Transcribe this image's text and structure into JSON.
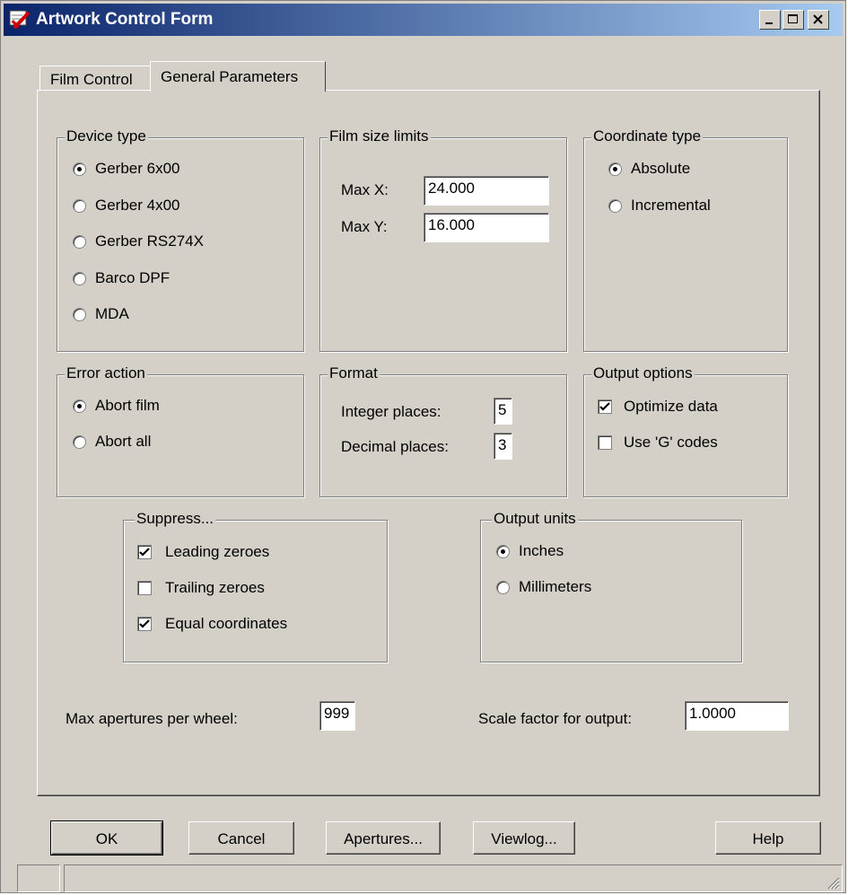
{
  "window": {
    "title": "Artwork Control Form",
    "titlebar_colors": {
      "start": "#0a246a",
      "end": "#a6caf0"
    },
    "face_color": "#d4d0c8",
    "caption_buttons": [
      "minimize-icon",
      "maximize-icon",
      "close-icon"
    ]
  },
  "tabs": [
    {
      "label": "Film Control",
      "selected": false
    },
    {
      "label": "General Parameters",
      "selected": true
    }
  ],
  "device_type": {
    "legend": "Device type",
    "selected": "Gerber 6x00",
    "options": [
      "Gerber 6x00",
      "Gerber 4x00",
      "Gerber RS274X",
      "Barco DPF",
      "MDA"
    ]
  },
  "film_size": {
    "legend": "Film size limits",
    "max_x_label": "Max X:",
    "max_x_value": "24.000",
    "max_y_label": "Max Y:",
    "max_y_value": "16.000"
  },
  "coordinate_type": {
    "legend": "Coordinate type",
    "selected": "Absolute",
    "options": [
      "Absolute",
      "Incremental"
    ]
  },
  "error_action": {
    "legend": "Error action",
    "selected": "Abort film",
    "options": [
      "Abort film",
      "Abort all"
    ]
  },
  "format": {
    "legend": "Format",
    "integer_label": "Integer places:",
    "integer_value": "5",
    "decimal_label": "Decimal places:",
    "decimal_value": "3"
  },
  "output_options": {
    "legend": "Output options",
    "items": [
      {
        "label": "Optimize data",
        "checked": true
      },
      {
        "label": "Use 'G' codes",
        "checked": false
      }
    ]
  },
  "suppress": {
    "legend": "Suppress...",
    "items": [
      {
        "label": "Leading zeroes",
        "checked": true
      },
      {
        "label": "Trailing zeroes",
        "checked": false
      },
      {
        "label": "Equal coordinates",
        "checked": true
      }
    ]
  },
  "output_units": {
    "legend": "Output units",
    "selected": "Inches",
    "options": [
      "Inches",
      "Millimeters"
    ]
  },
  "apertures": {
    "label": "Max apertures per wheel:",
    "value": "999"
  },
  "scale": {
    "label": "Scale factor for output:",
    "value": "1.0000"
  },
  "buttons": {
    "ok": "OK",
    "cancel": "Cancel",
    "apertures": "Apertures...",
    "viewlog": "Viewlog...",
    "help": "Help"
  }
}
